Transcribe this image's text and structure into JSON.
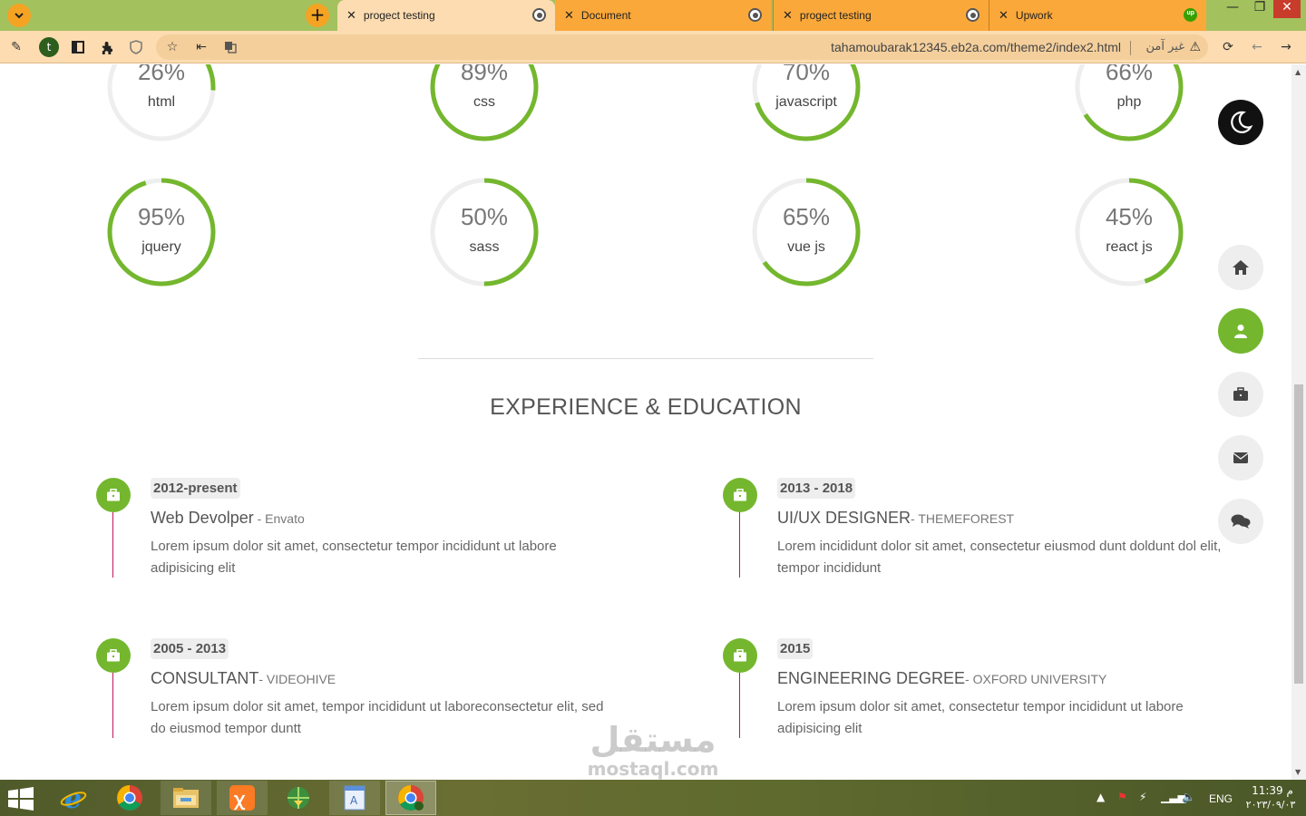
{
  "browser": {
    "tabs": [
      {
        "title": "progect testing",
        "active": true
      },
      {
        "title": "Document",
        "active": false
      },
      {
        "title": "progect testing",
        "active": false
      },
      {
        "title": "Upwork",
        "active": false
      }
    ],
    "new_tab_symbol": "+",
    "profile_initial": "t",
    "url": "tahamoubarak12345.eb2a.com/theme2/index2.html",
    "security_label": "غير آمن",
    "window_controls": [
      "—",
      "❐",
      "✕"
    ]
  },
  "skills": [
    {
      "name": "html",
      "percent": 26,
      "label": "26%"
    },
    {
      "name": "css",
      "percent": 89,
      "label": "89%"
    },
    {
      "name": "javascript",
      "percent": 70,
      "label": "70%"
    },
    {
      "name": "php",
      "percent": 66,
      "label": "66%"
    },
    {
      "name": "jquery",
      "percent": 95,
      "label": "95%"
    },
    {
      "name": "sass",
      "percent": 50,
      "label": "50%"
    },
    {
      "name": "vue js",
      "percent": 65,
      "label": "65%"
    },
    {
      "name": "react js",
      "percent": 45,
      "label": "45%"
    }
  ],
  "section_title": "EXPERIENCE & EDUCATION",
  "timeline": [
    {
      "date": "2012-present",
      "role": "Web Devolper",
      "org": " - Envato",
      "desc": "Lorem ipsum dolor sit amet, consectetur tempor incididunt ut labore adipisicing elit"
    },
    {
      "date": "2013 - 2018",
      "role": "UI/UX DESIGNER",
      "org": "- THEMEFOREST",
      "desc": "Lorem incididunt dolor sit amet, consectetur eiusmod dunt doldunt dol elit, tempor incididunt"
    },
    {
      "date": "2005 - 2013",
      "role": "CONSULTANT",
      "org": "- VIDEOHIVE",
      "desc": "Lorem ipsum dolor sit amet, tempor incididunt ut laboreconsectetur elit, sed do eiusmod tempor duntt"
    },
    {
      "date": "2015",
      "role": "ENGINEERING DEGREE",
      "org": "- OXFORD UNIVERSITY",
      "desc": "Lorem ipsum dolor sit amet, consectetur tempor incididunt ut labore adipisicing elit"
    }
  ],
  "side_nav": [
    {
      "icon": "moon-icon"
    },
    {
      "icon": "home-icon"
    },
    {
      "icon": "user-icon",
      "active": true
    },
    {
      "icon": "briefcase-icon"
    },
    {
      "icon": "envelope-icon"
    },
    {
      "icon": "comments-icon"
    }
  ],
  "watermark": {
    "arabic": "مستقل",
    "latin": "mostaql.com"
  },
  "taskbar": {
    "apps": [
      "internet-explorer",
      "chrome",
      "file-explorer",
      "xampp",
      "network-app",
      "notepad",
      "chrome-active"
    ],
    "language": "ENG",
    "time": "11:39 م",
    "date": "٢٠٢٣/٠٩/٠٣"
  },
  "colors": {
    "accent": "#74b72e",
    "track": "#eeeeee",
    "timeline_line": "#c2185b",
    "tab_orange": "#fba83a",
    "tab_active": "#fcdcb0"
  }
}
